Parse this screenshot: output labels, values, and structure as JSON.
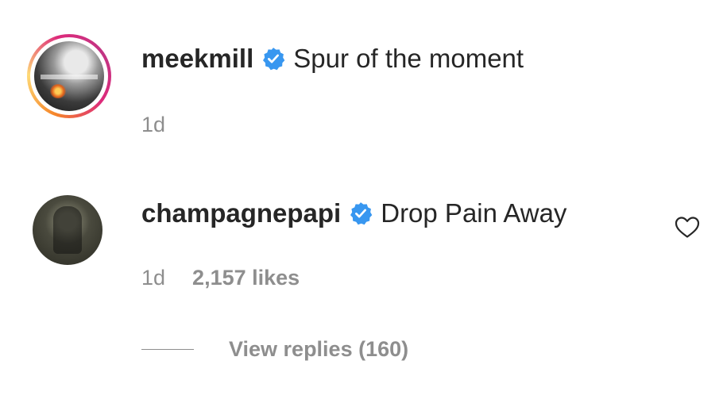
{
  "comments": [
    {
      "username": "meekmill",
      "verified": true,
      "text": "Spur of the moment",
      "time": "1d",
      "avatar_icon": "profile-photo-story-ring"
    },
    {
      "username": "champagnepapi",
      "verified": true,
      "text": "Drop Pain Away",
      "time": "1d",
      "likes": "2,157 likes",
      "avatar_icon": "profile-photo",
      "like_icon": "heart-outline-icon",
      "replies_label": "View replies (160)"
    }
  ],
  "colors": {
    "text": "#262626",
    "secondary": "#8e8e8e",
    "verified_blue": "#3897f0",
    "story_ring": [
      "#f58529",
      "#dd2a7b",
      "#c13584"
    ]
  }
}
